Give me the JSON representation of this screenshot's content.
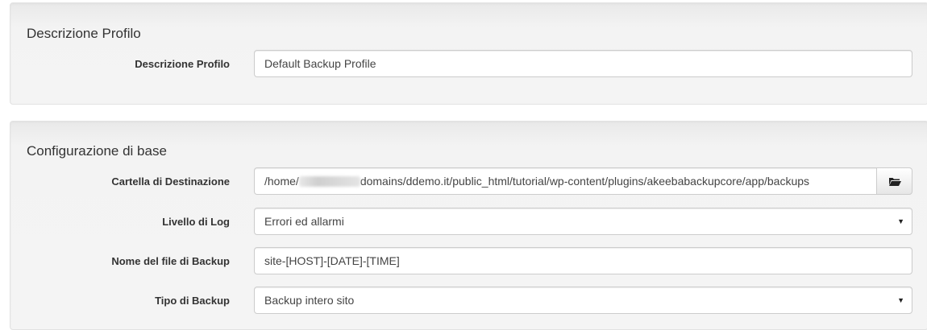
{
  "profile_section": {
    "title": "Descrizione Profilo",
    "description_label": "Descrizione Profilo",
    "description_value": "Default Backup Profile"
  },
  "basic_section": {
    "title": "Configurazione di base",
    "output_dir": {
      "label": "Cartella di Destinazione",
      "value_prefix": "/home/",
      "value_suffix": "domains/ddemo.it/public_html/tutorial/wp-content/plugins/akeebabackupcore/app/backups",
      "browse_icon": "folder-open-icon"
    },
    "log_level": {
      "label": "Livello di Log",
      "value": "Errori ed allarmi"
    },
    "archive_name": {
      "label": "Nome del file di Backup",
      "value": "site-[HOST]-[DATE]-[TIME]"
    },
    "backup_type": {
      "label": "Tipo di Backup",
      "value": "Backup intero sito"
    }
  }
}
